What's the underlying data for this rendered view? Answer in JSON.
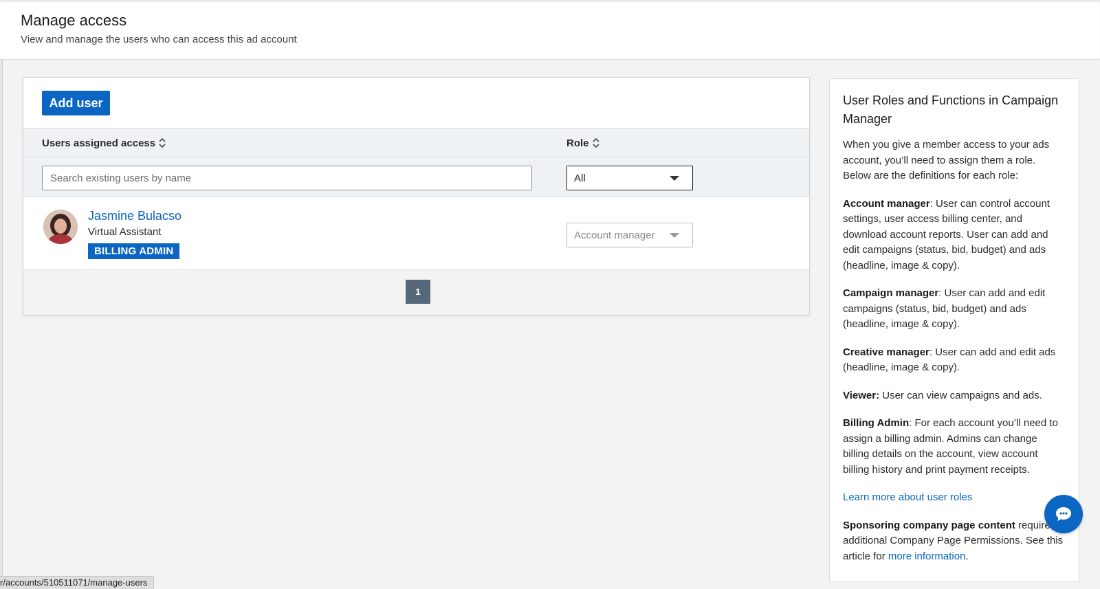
{
  "header": {
    "title": "Manage access",
    "subtitle": "View and manage the users who can access this ad account"
  },
  "toolbar": {
    "add_user_label": "Add user"
  },
  "table": {
    "columns": [
      "Users assigned access",
      "Role"
    ],
    "search_placeholder": "Search existing users by name",
    "role_filter_value": "All",
    "rows": [
      {
        "name": "Jasmine Bulacso",
        "title": "Virtual Assistant",
        "badge": "BILLING ADMIN",
        "role": "Account manager"
      }
    ],
    "pagination": {
      "current_page": "1"
    }
  },
  "sidebar": {
    "title": "User Roles and Functions in Campaign Manager",
    "intro": "When you give a member access to your ads account, you’ll need to assign them a role. Below are the definitions for each role:",
    "roles": [
      {
        "name": "Account manager",
        "desc": ": User can control account settings, user access billing center, and download account reports. User can add and edit campaigns (status, bid, budget) and ads (headline, image & copy)."
      },
      {
        "name": "Campaign manager",
        "desc": ": User can add and edit campaigns (status, bid, budget) and ads (headline, image & copy)."
      },
      {
        "name": "Creative manager",
        "desc": ": User can add and edit ads (headline, image & copy)."
      },
      {
        "name": "Viewer:",
        "desc": " User can view campaigns and ads."
      },
      {
        "name": "Billing Admin",
        "desc": ": For each account you’ll need to assign a billing admin. Admins can change billing details on the account, view account billing history and print payment receipts."
      }
    ],
    "learn_more_link": "Learn more about user roles",
    "sponsoring_bold": "Sponsoring company page content",
    "sponsoring_text": " requires additional Company Page Permissions. See this article for ",
    "more_info_link": "more information",
    "sponsoring_end": "."
  },
  "status_bar": {
    "url": "r/accounts/510511071/manage-users"
  },
  "colors": {
    "accent": "#0a66c2",
    "pager_active": "#56687a",
    "table_header_bg": "#eef2f5"
  },
  "icons": [
    "sort-icon",
    "dropdown-caret-icon",
    "chat-icon"
  ]
}
